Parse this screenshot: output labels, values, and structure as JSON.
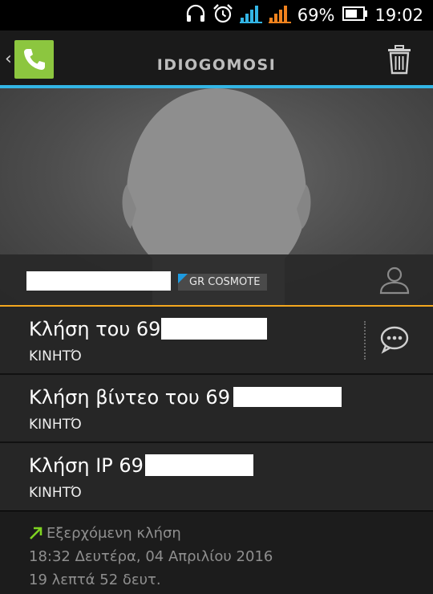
{
  "status": {
    "battery": "69%",
    "time": "19:02",
    "icons": [
      "headset-icon",
      "alarm-icon",
      "signal-icon",
      "signal-icon",
      "battery-icon"
    ],
    "signal_colors": [
      "#33b5e5",
      "#f0821e"
    ]
  },
  "actionbar": {
    "title": "IDIOGOMOSI",
    "back_glyph": "‹",
    "icons": [
      "phone-icon",
      "trash-icon"
    ],
    "accent": "#33b5e5",
    "app_icon_color": "#8cc63f"
  },
  "contact": {
    "carrier": "GR COSMOTE",
    "icons": [
      "person-icon"
    ],
    "divider_color": "#f4a71f"
  },
  "rows": [
    {
      "primary": "Κλήση του 69",
      "secondary": "ΚΙΝΗΤΌ"
    },
    {
      "primary": "Κλήση βίντεο του 69",
      "secondary": "ΚΙΝΗΤΌ"
    },
    {
      "primary": "Κλήση IP 69",
      "secondary": "ΚΙΝΗΤΌ"
    }
  ],
  "row_action_icon": "message-icon",
  "call_log": {
    "type": "Εξερχόμενη κλήση",
    "datetime": "18:32 Δευτέρα, 04 Απριλίου 2016",
    "duration": "19 λεπτά 52 δευτ.",
    "icon": "outgoing-arrow-icon",
    "arrow_color": "#7ed321"
  }
}
